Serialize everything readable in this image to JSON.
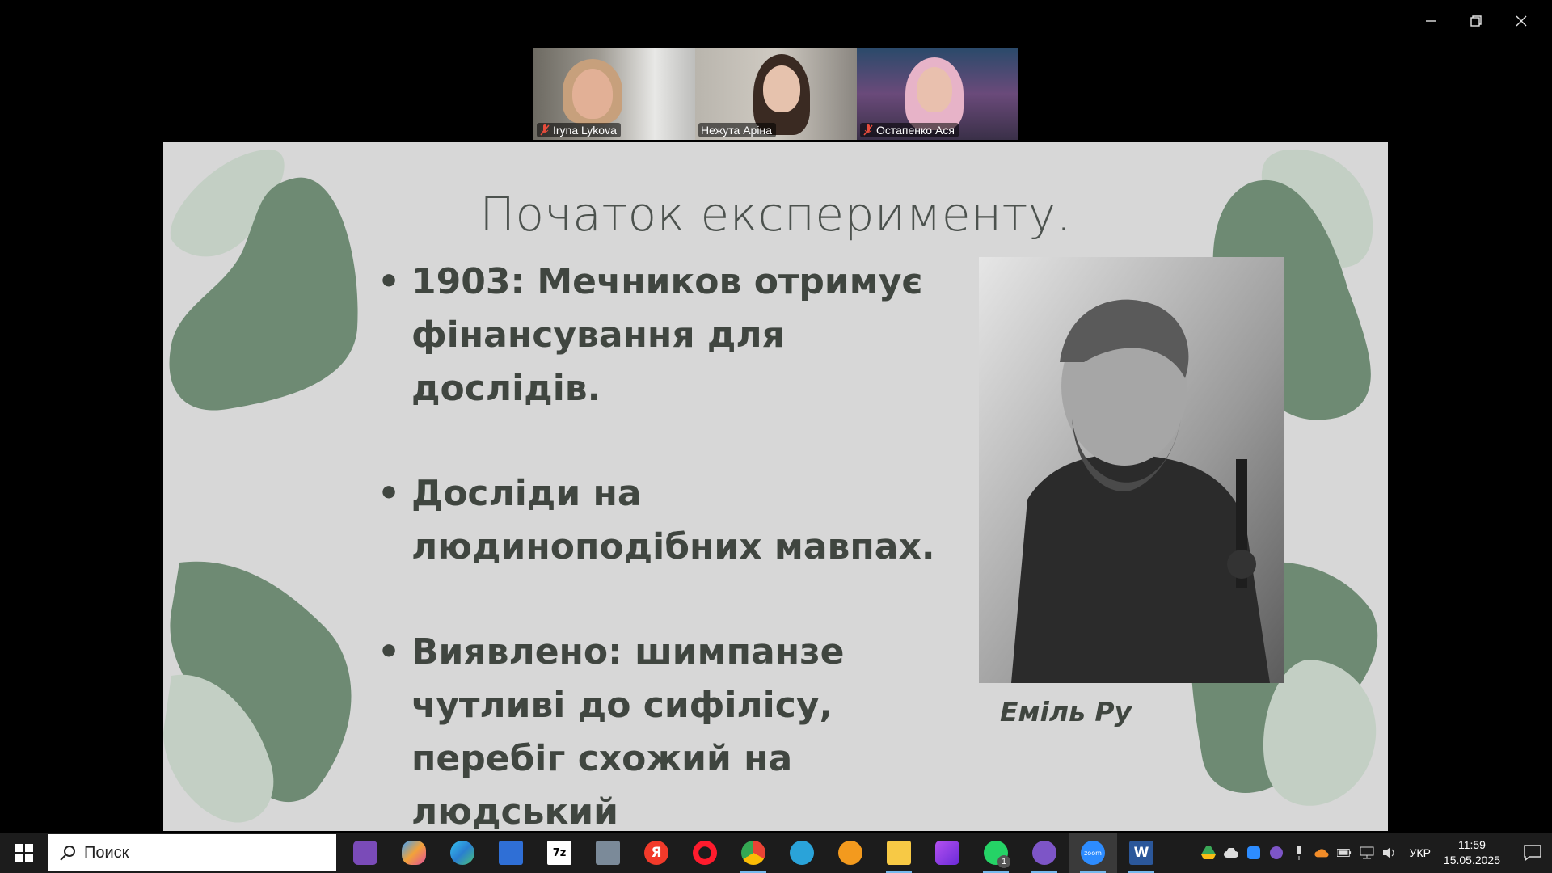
{
  "participants": [
    {
      "name": "Iryna Lykova",
      "muted": true
    },
    {
      "name": "Нежута Аріна",
      "muted": false,
      "active": true
    },
    {
      "name": "Остапенко Ася",
      "muted": true
    }
  ],
  "slide": {
    "title": "Початок експерименту.",
    "bullets": [
      "1903: Мечников отримує фінансування для дослідів.",
      " Досліди на людиноподібних мавпах.",
      " Виявлено: шимпанзе чутливі до сифілісу, перебіг схожий на людський"
    ],
    "caption": "Еміль Ру"
  },
  "taskbar": {
    "search_placeholder": "Поиск",
    "apps": [
      {
        "icon": "winrar-icon",
        "label": ""
      },
      {
        "icon": "copilot-icon",
        "label": ""
      },
      {
        "icon": "edge-icon",
        "label": ""
      },
      {
        "icon": "save-disk-icon",
        "label": ""
      },
      {
        "icon": "7zip-icon",
        "label": "7z"
      },
      {
        "icon": "calculator-icon",
        "label": ""
      },
      {
        "icon": "yandex-icon",
        "label": "Я"
      },
      {
        "icon": "opera-icon",
        "label": ""
      },
      {
        "icon": "chrome-icon",
        "label": ""
      },
      {
        "icon": "app-icon",
        "label": ""
      },
      {
        "icon": "network-app-icon",
        "label": ""
      },
      {
        "icon": "file-explorer-icon",
        "label": ""
      },
      {
        "icon": "visual-studio-icon",
        "label": ""
      },
      {
        "icon": "whatsapp-icon",
        "label": ""
      },
      {
        "icon": "viber-icon",
        "label": ""
      },
      {
        "icon": "zoom-icon",
        "label": "zoom"
      },
      {
        "icon": "word-icon",
        "label": "W"
      }
    ],
    "whatsapp_badge": "1",
    "language": "УКР",
    "time": "11:59",
    "date": "15.05.2025"
  },
  "colors": {
    "slide_bg": "#d7d7d7",
    "blob_dark": "#6e8a73",
    "blob_light": "#c3cfc4",
    "text": "#404640",
    "active_speaker": "#23d18b"
  }
}
